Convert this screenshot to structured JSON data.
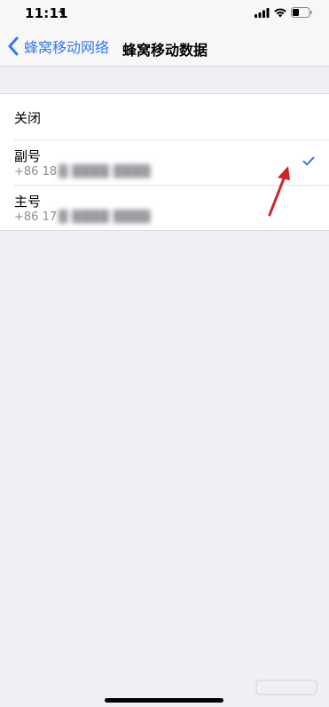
{
  "status_bar": {
    "time": "11:11",
    "icons": [
      "location-arrow-icon",
      "cellular-signal-icon",
      "wifi-icon",
      "battery-icon"
    ]
  },
  "nav": {
    "back_label": "蜂窝移动网络",
    "title": "蜂窝移动数据"
  },
  "options": [
    {
      "title": "关闭",
      "subtitle": "",
      "selected": false
    },
    {
      "title": "副号",
      "subtitle": "+86 18",
      "selected": true
    },
    {
      "title": "主号",
      "subtitle": "+86 17",
      "selected": false
    }
  ],
  "colors": {
    "accent": "#3478f6",
    "background": "#efeff4",
    "annotation": "#d0232b"
  }
}
